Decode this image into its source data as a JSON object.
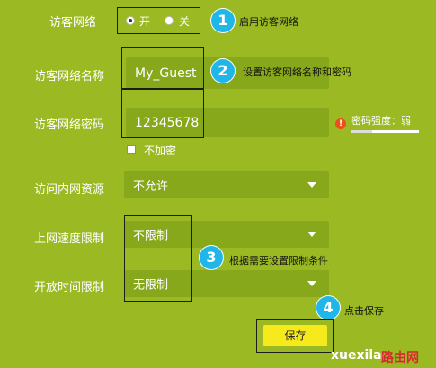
{
  "guest_network": {
    "label": "访客网络",
    "on_label": "开",
    "off_label": "关",
    "selected": "开"
  },
  "network_name": {
    "label": "访客网络名称",
    "value": "My_Guest"
  },
  "network_password": {
    "label": "访客网络密码",
    "value": "12345678",
    "strength_label": "密码强度：弱",
    "no_encrypt_label": "不加密"
  },
  "intranet_access": {
    "label": "访问内网资源",
    "value": "不允许"
  },
  "speed_limit": {
    "label": "上网速度限制",
    "value": "不限制"
  },
  "time_limit": {
    "label": "开放时间限制",
    "value": "无限制"
  },
  "save": {
    "label": "保存"
  },
  "annotations": [
    {
      "number": "1",
      "text": "启用访客网络"
    },
    {
      "number": "2",
      "text": "设置访客网络名称和密码"
    },
    {
      "number": "3",
      "text": "根据需要设置限制条件"
    },
    {
      "number": "4",
      "text": "点击保存"
    }
  ],
  "watermark": {
    "text": "xuexila",
    "text_accent": "路由网"
  },
  "colors": {
    "background": "#9bb923",
    "field": "#87a81b",
    "step_badge": "#20b6e8",
    "save_button": "#f7ea1c",
    "warning": "#e8511a"
  }
}
